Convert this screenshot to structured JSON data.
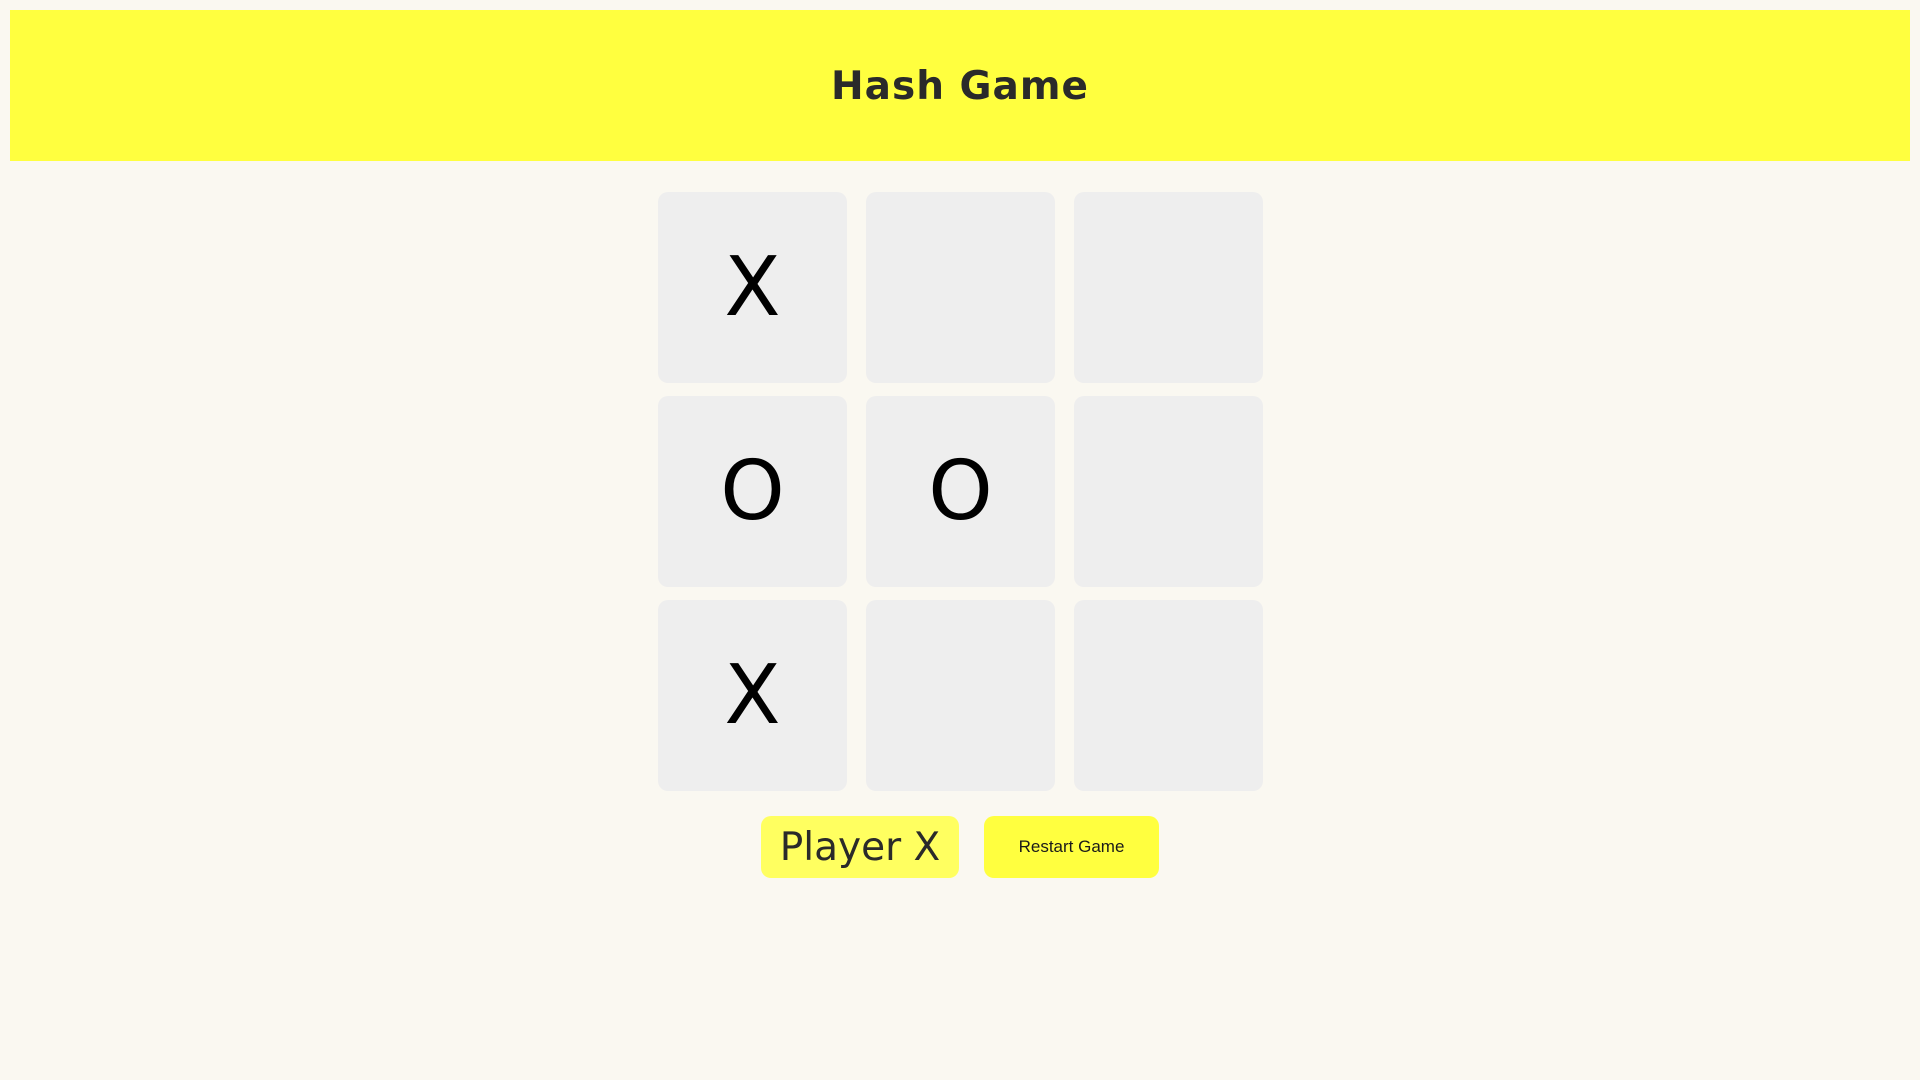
{
  "header": {
    "title": "Hash Game"
  },
  "board": {
    "cells": [
      "X",
      "",
      "",
      "O",
      "O",
      "",
      "X",
      "",
      ""
    ]
  },
  "status": {
    "player_label": "Player X"
  },
  "controls": {
    "restart_label": "Restart Game"
  },
  "colors": {
    "accent": "#ffff3f",
    "indicator": "#ffff60",
    "cell_bg": "#eeeeee",
    "page_bg": "#faf8f1"
  }
}
